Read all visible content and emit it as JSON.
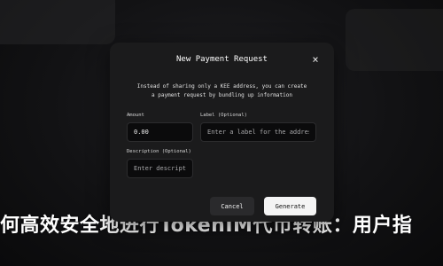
{
  "background": {
    "heading": "何高效安全地进行TokenIM代币转账：用户指"
  },
  "modal": {
    "title": "New Payment Request",
    "close_symbol": "×",
    "description_line1": "Instead of sharing only a KEE address, you can create",
    "description_line2": "a payment request by bundling up information"
  },
  "form": {
    "amount": {
      "label": "Amount",
      "value": "0.00"
    },
    "label_field": {
      "label": "Label (Optional)",
      "placeholder": "Enter a label for the address"
    },
    "description": {
      "label": "Description (Optional)",
      "placeholder": "Enter description"
    }
  },
  "actions": {
    "cancel_label": "Cancel",
    "generate_label": "Generate"
  },
  "colors": {
    "modal_bg": "#1b1b1c",
    "input_bg": "#0b0b0c",
    "primary_button": "#f4f4f4",
    "secondary_button": "#2a2a2c"
  }
}
